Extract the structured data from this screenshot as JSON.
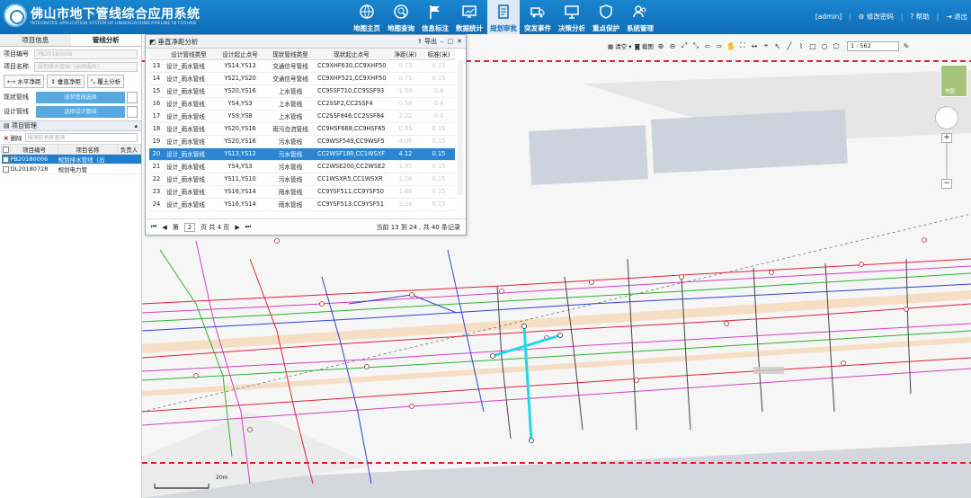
{
  "app": {
    "title": "佛山市地下管线综合应用系统",
    "subtitle": "INTEGRATED APPLICATION SYSTEM OF UNDERGROUND PIPELINE IN FOSHAN"
  },
  "nav": [
    {
      "label": "地图主页",
      "icon": "globe-icon"
    },
    {
      "label": "地图查询",
      "icon": "map-search-icon"
    },
    {
      "label": "信息标注",
      "icon": "flag-icon"
    },
    {
      "label": "数据统计",
      "icon": "monitor-chart-icon"
    },
    {
      "label": "规划审批",
      "icon": "document-icon"
    },
    {
      "label": "突发事件",
      "icon": "truck-icon"
    },
    {
      "label": "决策分析",
      "icon": "presentation-icon"
    },
    {
      "label": "重点保护",
      "icon": "shield-icon"
    },
    {
      "label": "系统管理",
      "icon": "users-icon"
    }
  ],
  "header_right": {
    "user": "[admin]",
    "change_password": "修改密码",
    "help": "帮助",
    "logout": "退出"
  },
  "left_panel": {
    "tabs": [
      "项目信息",
      "管线分析"
    ],
    "fields": [
      {
        "label": "项目编号",
        "value": "PB20180006"
      },
      {
        "label": "项目名称",
        "value": "规划排水管线（出图服务）"
      }
    ],
    "buttons": [
      "水平净距",
      "垂直净距",
      "覆土分析"
    ],
    "selectors": [
      {
        "label": "现状管线",
        "value": "现状管线选择"
      },
      {
        "label": "设计管线",
        "value": "选择设计管线"
      }
    ],
    "project_header": "项目管理",
    "delete_label": "删除",
    "search_placeholder": "按项目名称查询",
    "table_headers": [
      "项目编号",
      "项目名称",
      "负责人"
    ],
    "projects": [
      {
        "id": "PB20180006",
        "name": "规划排水管线（出",
        "owner": ""
      },
      {
        "id": "DL20180728",
        "name": "规划电力管",
        "owner": ""
      }
    ]
  },
  "toolbar": {
    "clear_label": "清空",
    "screenshot_label": "截图",
    "scale": "1 : 562"
  },
  "minimap_label": "地图",
  "dialog": {
    "title": "垂直净距分析",
    "export_label": "导出",
    "headers": [
      "",
      "设计管线类型",
      "设计起止点号",
      "现状管线类型",
      "现状起止点号",
      "净距(米)",
      "标准(米)"
    ],
    "rows": [
      {
        "n": "13",
        "dtype": "设计_雨水管线",
        "dpts": "YS14,YS13",
        "ctype": "交通信号管线",
        "cpts": "CC9XHF630,CC9XHF50",
        "net": "0.75",
        "std": "0.15"
      },
      {
        "n": "14",
        "dtype": "设计_雨水管线",
        "dpts": "YS21,YS20",
        "ctype": "交通信号管线",
        "cpts": "CC9XHF521,CC9XHF50",
        "net": "0.71",
        "std": "0.15"
      },
      {
        "n": "15",
        "dtype": "设计_雨水管线",
        "dpts": "YS20,YS16",
        "ctype": "上水管线",
        "cpts": "CC9SSF710,CC9SSF93",
        "net": "1.59",
        "std": "0.4"
      },
      {
        "n": "16",
        "dtype": "设计_雨水管线",
        "dpts": "YS4,YS3",
        "ctype": "上水管线",
        "cpts": "CC2SSF2,CC2SSF4",
        "net": "0.58",
        "std": "0.4"
      },
      {
        "n": "17",
        "dtype": "设计_雨水管线",
        "dpts": "YS9,YS8",
        "ctype": "上水管线",
        "cpts": "CC2SSF846,CC2SSF84",
        "net": "2.22",
        "std": "0.4"
      },
      {
        "n": "18",
        "dtype": "设计_雨水管线",
        "dpts": "YS20,YS16",
        "ctype": "雨污合流管线",
        "cpts": "CC9HSF668,CC9HSF65",
        "net": "0.65",
        "std": "0.15"
      },
      {
        "n": "19",
        "dtype": "设计_雨水管线",
        "dpts": "YS20,YS16",
        "ctype": "污水管线",
        "cpts": "CC9WSF549,CC9WSF5",
        "net": "4.06",
        "std": "0.15"
      },
      {
        "n": "20",
        "dtype": "设计_雨水管线",
        "dpts": "YS13,YS12",
        "ctype": "污水管线",
        "cpts": "CC2WSF188,CC1WSXF",
        "net": "4.12",
        "std": "0.15",
        "selected": true
      },
      {
        "n": "21",
        "dtype": "设计_雨水管线",
        "dpts": "YS4,YS3",
        "ctype": "污水管线",
        "cpts": "CC2WSE200,CC2WSE2",
        "net": "3.95",
        "std": "0.15"
      },
      {
        "n": "22",
        "dtype": "设计_雨水管线",
        "dpts": "YS11,YS10",
        "ctype": "污水管线",
        "cpts": "CC1WSXR5,CC1WSXR",
        "net": "1.26",
        "std": "0.15"
      },
      {
        "n": "23",
        "dtype": "设计_雨水管线",
        "dpts": "YS16,YS14",
        "ctype": "雨水管线",
        "cpts": "CC9YSF511,CC9YSF50",
        "net": "1.86",
        "std": "0.15"
      },
      {
        "n": "24",
        "dtype": "设计_雨水管线",
        "dpts": "YS16,YS14",
        "ctype": "雨水管线",
        "cpts": "CC9YSF513,CC9YSF51",
        "net": "2.24",
        "std": "0.15"
      }
    ],
    "pager": {
      "page_prefix": "第",
      "page": "2",
      "page_suffix": "页 共 4 页",
      "info": "当前 13 到 24 , 共 40 条记录"
    }
  },
  "map_label": "20m",
  "colors": {
    "header_blue": "#1577c4",
    "selected_row": "#2a85d3",
    "pipe_red": "#e0203c",
    "pipe_magenta": "#d040c0",
    "pipe_green": "#30b030",
    "pipe_blue": "#3040d0",
    "highlight_cyan": "#20d8e8"
  }
}
